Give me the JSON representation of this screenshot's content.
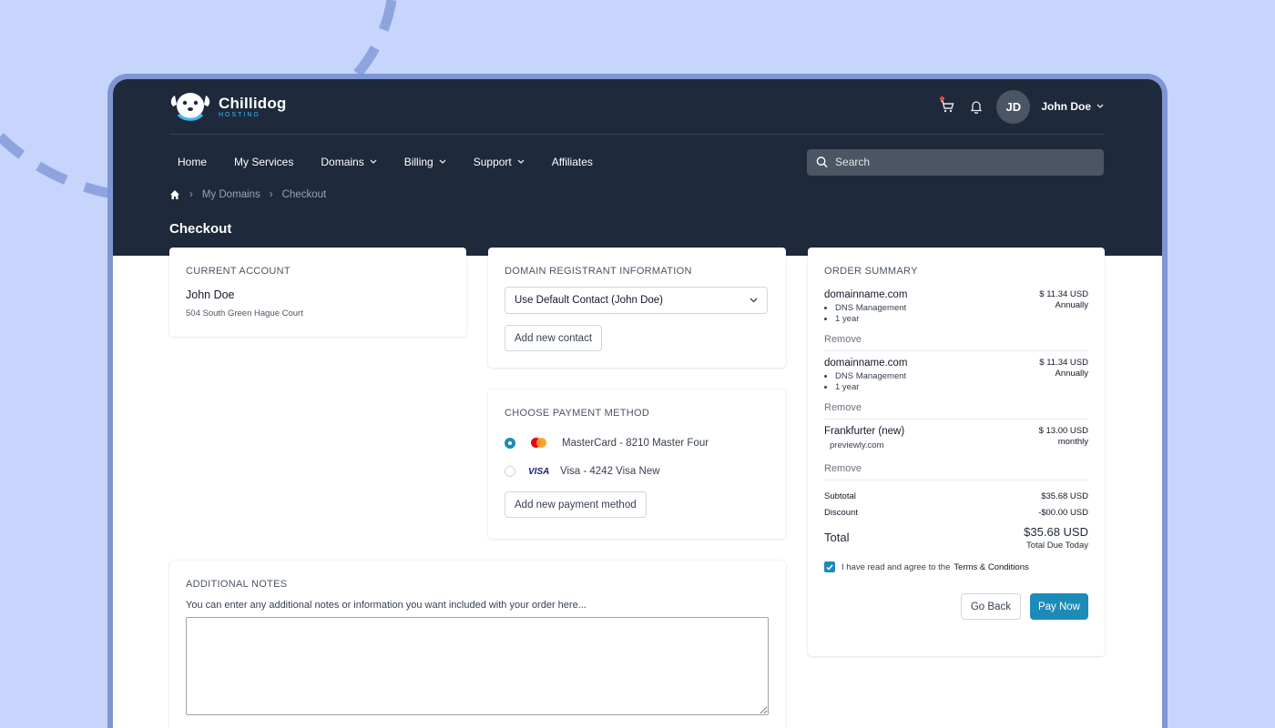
{
  "brand": {
    "name": "Chillidog",
    "sub": "HOSTING"
  },
  "user": {
    "initials": "JD",
    "name": "John Doe"
  },
  "nav": {
    "items": [
      {
        "label": "Home",
        "dropdown": false
      },
      {
        "label": "My Services",
        "dropdown": false
      },
      {
        "label": "Domains",
        "dropdown": true
      },
      {
        "label": "Billing",
        "dropdown": true
      },
      {
        "label": "Support",
        "dropdown": true
      },
      {
        "label": "Affiliates",
        "dropdown": false
      }
    ],
    "search_placeholder": "Search"
  },
  "breadcrumb": {
    "items": [
      "My Domains",
      "Checkout"
    ]
  },
  "page": {
    "title": "Checkout"
  },
  "current_account": {
    "title": "CURRENT ACCOUNT",
    "name": "John Doe",
    "address": "504 South Green Hague Court"
  },
  "registrant": {
    "title": "DOMAIN REGISTRANT INFORMATION",
    "selected": "Use Default Contact (John Doe)",
    "add_button": "Add new contact"
  },
  "payment": {
    "title": "CHOOSE PAYMENT METHOD",
    "methods": [
      {
        "brand": "MasterCard",
        "label": "MasterCard - 8210 Master Four",
        "selected": true
      },
      {
        "brand": "VISA",
        "label": "Visa - 4242 Visa New",
        "selected": false
      }
    ],
    "add_button": "Add new payment method"
  },
  "notes": {
    "title": "ADDITIONAL NOTES",
    "hint": "You can enter any additional notes or information you want included with your order here..."
  },
  "order_summary": {
    "title": "ORDER SUMMARY",
    "items": [
      {
        "name": "domainname.com",
        "features": [
          "DNS Management",
          "1 year"
        ],
        "price": "$ 11.34 USD",
        "cycle": "Annually",
        "remove": "Remove"
      },
      {
        "name": "domainname.com",
        "features": [
          "DNS Management",
          "1 year"
        ],
        "price": "$ 11.34 USD",
        "cycle": "Annually",
        "remove": "Remove"
      },
      {
        "name": "Frankfurter (new)",
        "sub": "previewly.com",
        "price": "$ 13.00 USD",
        "cycle": "monthly",
        "remove": "Remove"
      }
    ],
    "subtotal_label": "Subtotal",
    "subtotal": "$35.68 USD",
    "discount_label": "Discount",
    "discount": "-$00.00 USD",
    "total_label": "Total",
    "total": "$35.68 USD",
    "total_note": "Total Due Today",
    "terms_prefix": "I have read and agree to the",
    "terms_link": "Terms & Conditions",
    "terms_checked": true,
    "back_button": "Go Back",
    "pay_button": "Pay Now"
  },
  "colors": {
    "header_bg": "#1e293b",
    "accent": "#1d8bb8",
    "page_bg": "#c7d4fb",
    "frame": "#7f95d4"
  }
}
